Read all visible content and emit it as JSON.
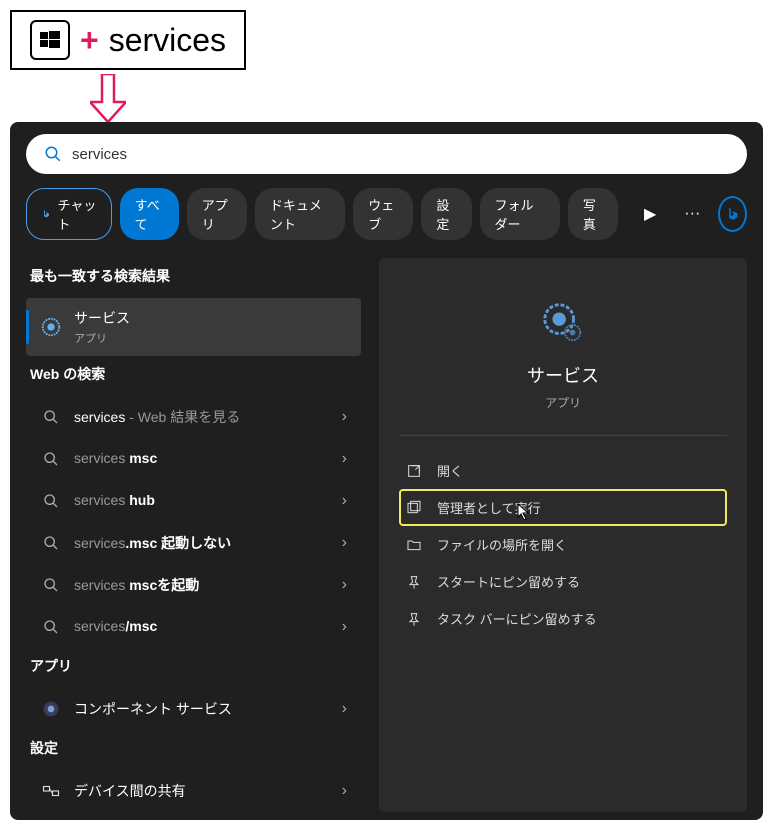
{
  "hint": {
    "text": "services"
  },
  "search": {
    "value": "services"
  },
  "filters": {
    "chat": "チャット",
    "all": "すべて",
    "apps": "アプリ",
    "docs": "ドキュメント",
    "web": "ウェブ",
    "settings": "設定",
    "folder": "フォルダー",
    "photos": "写真"
  },
  "sections": {
    "best_match": "最も一致する検索結果",
    "web_search": "Web の検索",
    "apps": "アプリ",
    "settings": "設定"
  },
  "results": {
    "best": {
      "title": "サービス",
      "sub": "アプリ"
    },
    "web": [
      {
        "text": "services",
        "suffix": " - Web 結果を見る"
      },
      {
        "text": "services ",
        "bold": "msc"
      },
      {
        "text": "services ",
        "bold": "hub"
      },
      {
        "text": "services",
        "bold": ".msc 起動しない"
      },
      {
        "text": "services ",
        "bold": "mscを起動"
      },
      {
        "text": "services",
        "bold": "/msc"
      }
    ],
    "app": {
      "title": "コンポーネント サービス"
    },
    "setting": {
      "title": "デバイス間の共有"
    }
  },
  "preview": {
    "title": "サービス",
    "sub": "アプリ",
    "actions": {
      "open": "開く",
      "admin": "管理者として実行",
      "location": "ファイルの場所を開く",
      "pin_start": "スタートにピン留めする",
      "pin_task": "タスク バーにピン留めする"
    }
  }
}
